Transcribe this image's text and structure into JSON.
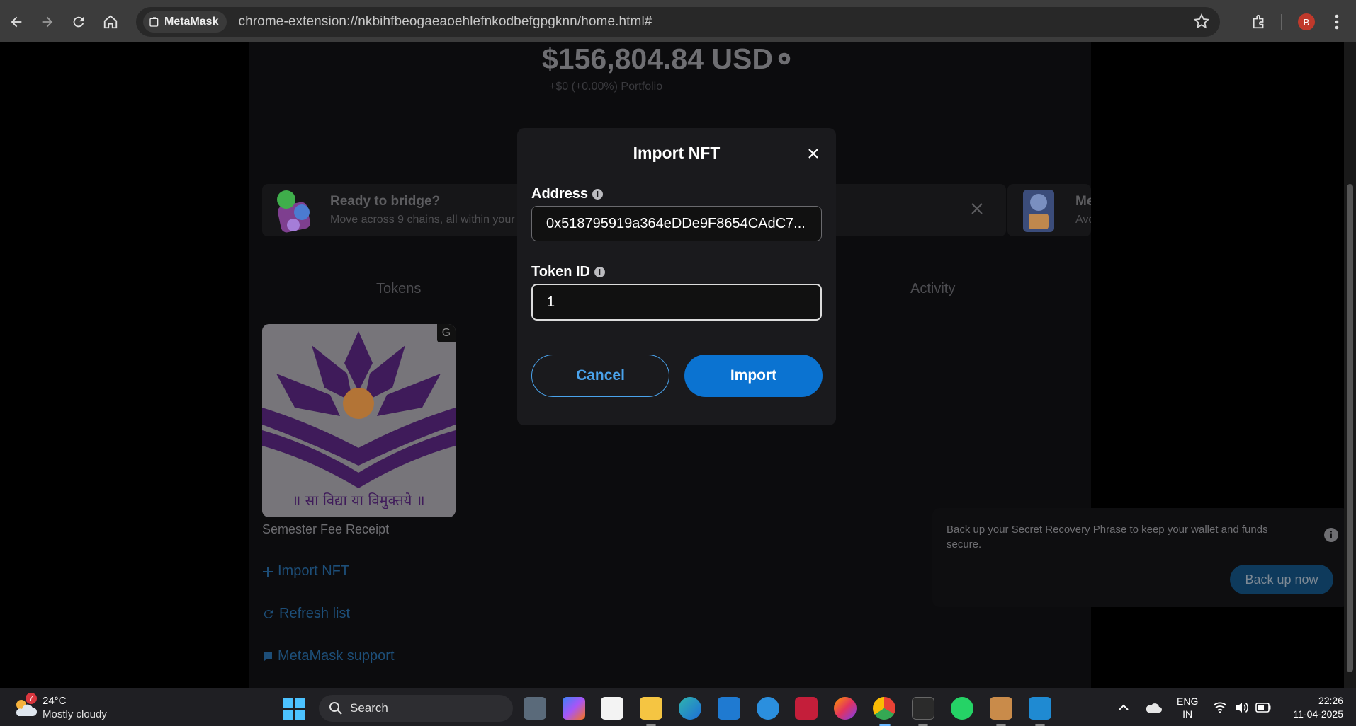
{
  "browser": {
    "site_chip": "MetaMask",
    "url": "chrome-extension://nkbihfbeogaeaoehlefnkodbefgpgknn/home.html#",
    "profile_initial": "B"
  },
  "wallet": {
    "balance": "$156,804.84 USD",
    "sub_balance": "+$0 (+0.00%)  Portfolio"
  },
  "banners": [
    {
      "title": "Ready to bridge?",
      "text": "Move across 9 chains, all within your wallet"
    },
    {
      "title": "Me",
      "text": "Avo"
    }
  ],
  "tabs": [
    "Tokens",
    "Activity"
  ],
  "nft": {
    "name": "Semester Fee Receipt",
    "badge": "G",
    "image_text": "॥ सा विद्या या विमुक्तये ॥"
  },
  "links": {
    "import_nft": "Import NFT",
    "refresh_list": "Refresh list",
    "support": "MetaMask support"
  },
  "backup": {
    "text": "Back up your Secret Recovery Phrase to keep your wallet and funds secure.",
    "button": "Back up now"
  },
  "modal": {
    "title": "Import NFT",
    "address_label": "Address",
    "address_value": "0x518795919a364eDDe9F8654CAdC7...",
    "token_label": "Token ID",
    "token_value": "1",
    "cancel": "Cancel",
    "import": "Import"
  },
  "taskbar": {
    "weather_badge": "7",
    "temperature": "24°C",
    "weather": "Mostly cloudy",
    "search": "Search",
    "lang_top": "ENG",
    "lang_bottom": "IN",
    "time": "22:26",
    "date": "11-04-2025"
  },
  "colors": {
    "primary": "#0b73d1",
    "modal_bg": "#1a1a1d",
    "page_bg": "#0c0c0e"
  }
}
